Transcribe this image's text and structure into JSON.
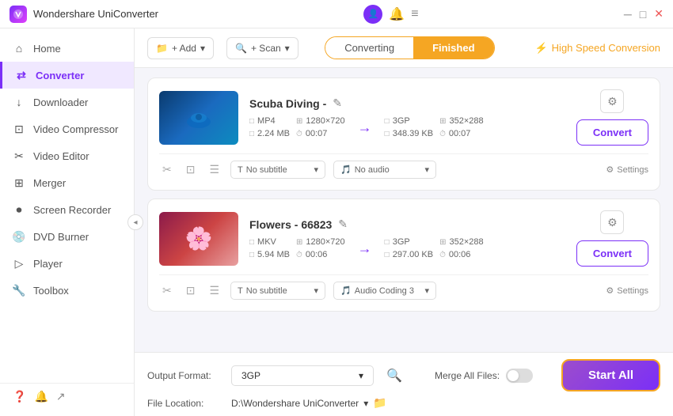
{
  "app": {
    "title": "Wondershare UniConverter",
    "logo_letter": "W"
  },
  "titlebar": {
    "icons": [
      "user",
      "bell",
      "menu"
    ],
    "controls": [
      "minimize",
      "maximize",
      "close"
    ]
  },
  "sidebar": {
    "items": [
      {
        "id": "home",
        "label": "Home",
        "icon": "⌂",
        "active": false
      },
      {
        "id": "converter",
        "label": "Converter",
        "icon": "⇄",
        "active": true
      },
      {
        "id": "downloader",
        "label": "Downloader",
        "icon": "↓",
        "active": false
      },
      {
        "id": "video-compressor",
        "label": "Video Compressor",
        "icon": "⊡",
        "active": false
      },
      {
        "id": "video-editor",
        "label": "Video Editor",
        "icon": "✂",
        "active": false
      },
      {
        "id": "merger",
        "label": "Merger",
        "icon": "⊞",
        "active": false
      },
      {
        "id": "screen-recorder",
        "label": "Screen Recorder",
        "icon": "▶",
        "active": false
      },
      {
        "id": "dvd-burner",
        "label": "DVD Burner",
        "icon": "◉",
        "active": false
      },
      {
        "id": "player",
        "label": "Player",
        "icon": "▷",
        "active": false
      },
      {
        "id": "toolbox",
        "label": "Toolbox",
        "icon": "⊞",
        "active": false
      }
    ],
    "bottom_icons": [
      "question",
      "bell",
      "share"
    ]
  },
  "toolbar": {
    "add_btn_label": "+ Add",
    "scan_btn_label": "+ Scan",
    "tabs": [
      {
        "label": "Converting",
        "active": false
      },
      {
        "label": "Finished",
        "active": true
      }
    ],
    "high_speed_label": "High Speed Conversion"
  },
  "items": [
    {
      "id": "item1",
      "title": "Scuba Diving -",
      "source_format": "MP4",
      "source_res": "1280×720",
      "source_size": "2.24 MB",
      "source_duration": "00:07",
      "target_format": "3GP",
      "target_res": "352×288",
      "target_size": "348.39 KB",
      "target_duration": "00:07",
      "subtitle": "No subtitle",
      "audio": "No audio",
      "convert_btn": "Convert"
    },
    {
      "id": "item2",
      "title": "Flowers - 66823",
      "source_format": "MKV",
      "source_res": "1280×720",
      "source_size": "5.94 MB",
      "source_duration": "00:06",
      "target_format": "3GP",
      "target_res": "352×288",
      "target_size": "297.00 KB",
      "target_duration": "00:06",
      "subtitle": "No subtitle",
      "audio": "Audio Coding 3",
      "convert_btn": "Convert"
    }
  ],
  "bottom": {
    "output_format_label": "Output Format:",
    "output_format_value": "3GP",
    "file_location_label": "File Location:",
    "file_location_value": "D:\\Wondershare UniConverter",
    "merge_label": "Merge All Files:",
    "start_all_label": "Start All"
  }
}
